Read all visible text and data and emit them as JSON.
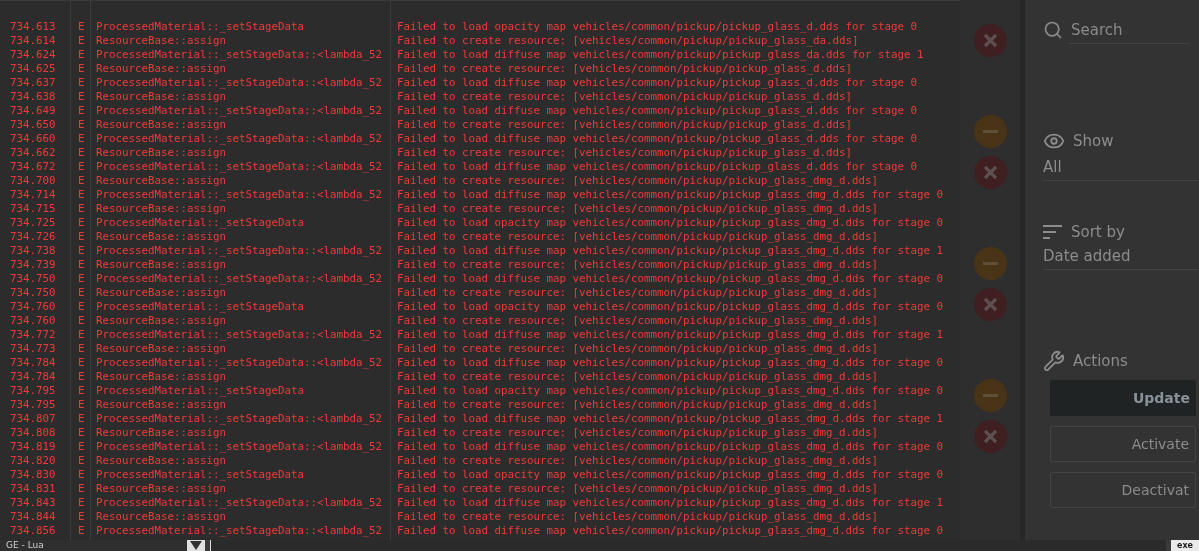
{
  "log": {
    "rows": [
      {
        "time": "734.613",
        "level": "E",
        "source": "ProcessedMaterial::_setStageData",
        "message": "Failed to load opacity map vehicles/common/pickup/pickup_glass_d.dds for stage 0"
      },
      {
        "time": "734.614",
        "level": "E",
        "source": "ResourceBase::assign",
        "message": "Failed to create resource: [vehicles/common/pickup/pickup_glass_da.dds]"
      },
      {
        "time": "734.624",
        "level": "E",
        "source": "ProcessedMaterial::_setStageData::<lambda_52",
        "message": "Failed to load diffuse map vehicles/common/pickup/pickup_glass_da.dds for stage 1"
      },
      {
        "time": "734.625",
        "level": "E",
        "source": "ResourceBase::assign",
        "message": "Failed to create resource: [vehicles/common/pickup/pickup_glass_d.dds]"
      },
      {
        "time": "734.637",
        "level": "E",
        "source": "ProcessedMaterial::_setStageData::<lambda_52",
        "message": "Failed to load diffuse map vehicles/common/pickup/pickup_glass_d.dds for stage 0"
      },
      {
        "time": "734.638",
        "level": "E",
        "source": "ResourceBase::assign",
        "message": "Failed to create resource: [vehicles/common/pickup/pickup_glass_d.dds]"
      },
      {
        "time": "734.649",
        "level": "E",
        "source": "ProcessedMaterial::_setStageData::<lambda_52",
        "message": "Failed to load diffuse map vehicles/common/pickup/pickup_glass_d.dds for stage 0"
      },
      {
        "time": "734.650",
        "level": "E",
        "source": "ResourceBase::assign",
        "message": "Failed to create resource: [vehicles/common/pickup/pickup_glass_d.dds]"
      },
      {
        "time": "734.660",
        "level": "E",
        "source": "ProcessedMaterial::_setStageData::<lambda_52",
        "message": "Failed to load diffuse map vehicles/common/pickup/pickup_glass_d.dds for stage 0"
      },
      {
        "time": "734.662",
        "level": "E",
        "source": "ResourceBase::assign",
        "message": "Failed to create resource: [vehicles/common/pickup/pickup_glass_d.dds]"
      },
      {
        "time": "734.672",
        "level": "E",
        "source": "ProcessedMaterial::_setStageData::<lambda_52",
        "message": "Failed to load diffuse map vehicles/common/pickup/pickup_glass_d.dds for stage 0"
      },
      {
        "time": "734.700",
        "level": "E",
        "source": "ResourceBase::assign",
        "message": "Failed to create resource: [vehicles/common/pickup/pickup_glass_dmg_d.dds]"
      },
      {
        "time": "734.714",
        "level": "E",
        "source": "ProcessedMaterial::_setStageData::<lambda_52",
        "message": "Failed to load diffuse map vehicles/common/pickup/pickup_glass_dmg_d.dds for stage 0"
      },
      {
        "time": "734.715",
        "level": "E",
        "source": "ResourceBase::assign",
        "message": "Failed to create resource: [vehicles/common/pickup/pickup_glass_dmg_d.dds]"
      },
      {
        "time": "734.725",
        "level": "E",
        "source": "ProcessedMaterial::_setStageData",
        "message": "Failed to load opacity map vehicles/common/pickup/pickup_glass_dmg_d.dds for stage 0"
      },
      {
        "time": "734.726",
        "level": "E",
        "source": "ResourceBase::assign",
        "message": "Failed to create resource: [vehicles/common/pickup/pickup_glass_dmg_d.dds]"
      },
      {
        "time": "734.738",
        "level": "E",
        "source": "ProcessedMaterial::_setStageData::<lambda_52",
        "message": "Failed to load diffuse map vehicles/common/pickup/pickup_glass_dmg_d.dds for stage 1"
      },
      {
        "time": "734.739",
        "level": "E",
        "source": "ResourceBase::assign",
        "message": "Failed to create resource: [vehicles/common/pickup/pickup_glass_dmg_d.dds]"
      },
      {
        "time": "734.750",
        "level": "E",
        "source": "ProcessedMaterial::_setStageData::<lambda_52",
        "message": "Failed to load diffuse map vehicles/common/pickup/pickup_glass_dmg_d.dds for stage 0"
      },
      {
        "time": "734.750",
        "level": "E",
        "source": "ResourceBase::assign",
        "message": "Failed to create resource: [vehicles/common/pickup/pickup_glass_dmg_d.dds]"
      },
      {
        "time": "734.760",
        "level": "E",
        "source": "ProcessedMaterial::_setStageData",
        "message": "Failed to load opacity map vehicles/common/pickup/pickup_glass_dmg_d.dds for stage 0"
      },
      {
        "time": "734.760",
        "level": "E",
        "source": "ResourceBase::assign",
        "message": "Failed to create resource: [vehicles/common/pickup/pickup_glass_dmg_d.dds]"
      },
      {
        "time": "734.772",
        "level": "E",
        "source": "ProcessedMaterial::_setStageData::<lambda_52",
        "message": "Failed to load diffuse map vehicles/common/pickup/pickup_glass_dmg_d.dds for stage 1"
      },
      {
        "time": "734.773",
        "level": "E",
        "source": "ResourceBase::assign",
        "message": "Failed to create resource: [vehicles/common/pickup/pickup_glass_dmg_d.dds]"
      },
      {
        "time": "734.784",
        "level": "E",
        "source": "ProcessedMaterial::_setStageData::<lambda_52",
        "message": "Failed to load diffuse map vehicles/common/pickup/pickup_glass_dmg_d.dds for stage 0"
      },
      {
        "time": "734.784",
        "level": "E",
        "source": "ResourceBase::assign",
        "message": "Failed to create resource: [vehicles/common/pickup/pickup_glass_dmg_d.dds]"
      },
      {
        "time": "734.795",
        "level": "E",
        "source": "ProcessedMaterial::_setStageData",
        "message": "Failed to load opacity map vehicles/common/pickup/pickup_glass_dmg_d.dds for stage 0"
      },
      {
        "time": "734.795",
        "level": "E",
        "source": "ResourceBase::assign",
        "message": "Failed to create resource: [vehicles/common/pickup/pickup_glass_dmg_d.dds]"
      },
      {
        "time": "734.807",
        "level": "E",
        "source": "ProcessedMaterial::_setStageData::<lambda_52",
        "message": "Failed to load diffuse map vehicles/common/pickup/pickup_glass_dmg_d.dds for stage 1"
      },
      {
        "time": "734.808",
        "level": "E",
        "source": "ResourceBase::assign",
        "message": "Failed to create resource: [vehicles/common/pickup/pickup_glass_dmg_d.dds]"
      },
      {
        "time": "734.819",
        "level": "E",
        "source": "ProcessedMaterial::_setStageData::<lambda_52",
        "message": "Failed to load diffuse map vehicles/common/pickup/pickup_glass_dmg_d.dds for stage 0"
      },
      {
        "time": "734.820",
        "level": "E",
        "source": "ResourceBase::assign",
        "message": "Failed to create resource: [vehicles/common/pickup/pickup_glass_dmg_d.dds]"
      },
      {
        "time": "734.830",
        "level": "E",
        "source": "ProcessedMaterial::_setStageData",
        "message": "Failed to load opacity map vehicles/common/pickup/pickup_glass_dmg_d.dds for stage 0"
      },
      {
        "time": "734.831",
        "level": "E",
        "source": "ResourceBase::assign",
        "message": "Failed to create resource: [vehicles/common/pickup/pickup_glass_dmg_d.dds]"
      },
      {
        "time": "734.843",
        "level": "E",
        "source": "ProcessedMaterial::_setStageData::<lambda_52",
        "message": "Failed to load diffuse map vehicles/common/pickup/pickup_glass_dmg_d.dds for stage 1"
      },
      {
        "time": "734.844",
        "level": "E",
        "source": "ResourceBase::assign",
        "message": "Failed to create resource: [vehicles/common/pickup/pickup_glass_dmg_d.dds]"
      },
      {
        "time": "734.856",
        "level": "E",
        "source": "ProcessedMaterial::_setStageData::<lambda_52",
        "message": "Failed to load diffuse map vehicles/common/pickup/pickup_glass_dmg_d.dds for stage 0"
      }
    ]
  },
  "mod_actions": [
    {
      "kind": "remove"
    },
    {
      "kind": "disable"
    },
    {
      "kind": "remove"
    },
    {
      "kind": "disable"
    },
    {
      "kind": "remove"
    },
    {
      "kind": "disable"
    },
    {
      "kind": "remove"
    }
  ],
  "sidebar": {
    "search": {
      "placeholder": "Search"
    },
    "show": {
      "label": "Show",
      "value": "All"
    },
    "sort": {
      "label": "Sort by",
      "value": "Date added"
    },
    "actions": {
      "label": "Actions",
      "buttons": [
        {
          "label": "Update",
          "kind": "primary"
        },
        {
          "label": "Activate",
          "kind": "secondary"
        },
        {
          "label": "Deactivat",
          "kind": "secondary"
        }
      ]
    }
  },
  "console_bar": {
    "context": "GE - Lua",
    "run_button": "exe"
  }
}
